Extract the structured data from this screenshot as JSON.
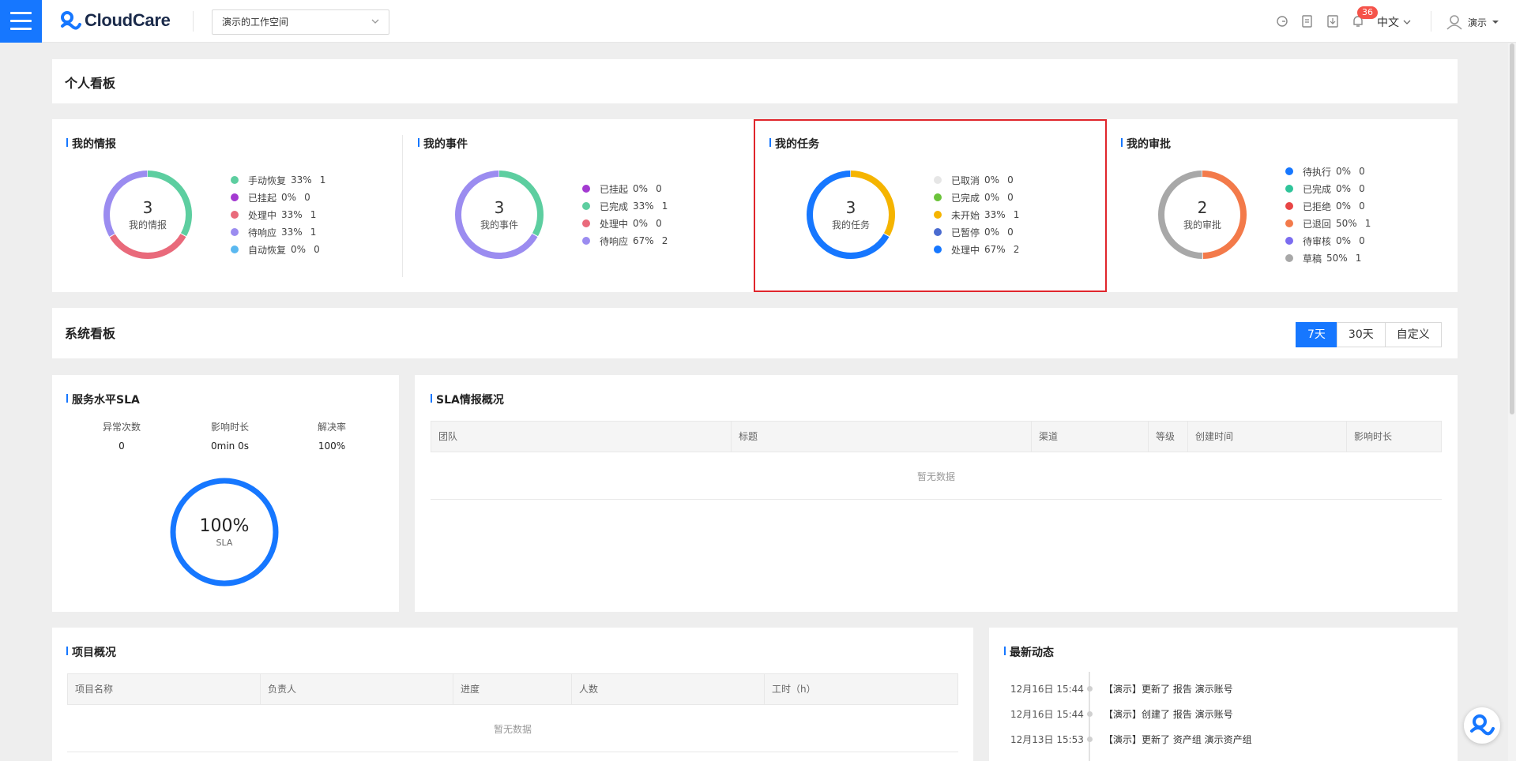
{
  "header": {
    "menu_icon": "hamburger-menu-icon",
    "logo_text": "CloudCare",
    "workspace": "演示的工作空间",
    "notifications_count": "36",
    "language": "中文",
    "user_name": "演示"
  },
  "personal_board": {
    "title": "个人看板",
    "sections": [
      {
        "title": "我的情报",
        "total": "3",
        "center_label": "我的情报",
        "legend": [
          {
            "label": "手动恢复",
            "pct": "33%",
            "count": "1",
            "color": "#5dcea0"
          },
          {
            "label": "已挂起",
            "pct": "0%",
            "count": "0",
            "color": "#a33ad1"
          },
          {
            "label": "处理中",
            "pct": "33%",
            "count": "1",
            "color": "#e96a7b"
          },
          {
            "label": "待响应",
            "pct": "33%",
            "count": "1",
            "color": "#9b8cf0"
          },
          {
            "label": "自动恢复",
            "pct": "0%",
            "count": "0",
            "color": "#5ab8f0"
          }
        ]
      },
      {
        "title": "我的事件",
        "total": "3",
        "center_label": "我的事件",
        "legend": [
          {
            "label": "已挂起",
            "pct": "0%",
            "count": "0",
            "color": "#a33ad1"
          },
          {
            "label": "已完成",
            "pct": "33%",
            "count": "1",
            "color": "#5dcea0"
          },
          {
            "label": "处理中",
            "pct": "0%",
            "count": "0",
            "color": "#e96a7b"
          },
          {
            "label": "待响应",
            "pct": "67%",
            "count": "2",
            "color": "#9b8cf0"
          }
        ]
      },
      {
        "title": "我的任务",
        "total": "3",
        "center_label": "我的任务",
        "legend": [
          {
            "label": "已取消",
            "pct": "0%",
            "count": "0",
            "color": "#e6e6e6"
          },
          {
            "label": "已完成",
            "pct": "0%",
            "count": "0",
            "color": "#6bc33a"
          },
          {
            "label": "未开始",
            "pct": "33%",
            "count": "1",
            "color": "#f5b400"
          },
          {
            "label": "已暂停",
            "pct": "0%",
            "count": "0",
            "color": "#4a6bd0"
          },
          {
            "label": "处理中",
            "pct": "67%",
            "count": "2",
            "color": "#1677ff"
          }
        ]
      },
      {
        "title": "我的审批",
        "total": "2",
        "center_label": "我的审批",
        "legend": [
          {
            "label": "待执行",
            "pct": "0%",
            "count": "0",
            "color": "#1677ff"
          },
          {
            "label": "已完成",
            "pct": "0%",
            "count": "0",
            "color": "#2fc49a"
          },
          {
            "label": "已拒绝",
            "pct": "0%",
            "count": "0",
            "color": "#e84545"
          },
          {
            "label": "已退回",
            "pct": "50%",
            "count": "1",
            "color": "#f37a4a"
          },
          {
            "label": "待审核",
            "pct": "0%",
            "count": "0",
            "color": "#7b6cf0"
          },
          {
            "label": "草稿",
            "pct": "50%",
            "count": "1",
            "color": "#a8a8a8"
          }
        ]
      }
    ]
  },
  "system_board": {
    "title": "系统看板",
    "tabs": [
      "7天",
      "30天",
      "自定义"
    ],
    "active_tab": "7天"
  },
  "sla": {
    "title": "服务水平SLA",
    "stats": [
      {
        "label": "异常次数",
        "value": "0"
      },
      {
        "label": "影响时长",
        "value": "0min 0s"
      },
      {
        "label": "解决率",
        "value": "100%"
      }
    ],
    "gauge_value": "100%",
    "gauge_label": "SLA",
    "gauge_fraction": 1.0,
    "gauge_color": "#1677ff"
  },
  "sla_overview": {
    "title": "SLA情报概况",
    "columns": [
      "团队",
      "标题",
      "渠道",
      "等级",
      "创建时间",
      "影响时长"
    ],
    "empty_text": "暂无数据"
  },
  "projects": {
    "title": "项目概况",
    "columns": [
      "项目名称",
      "负责人",
      "进度",
      "人数",
      "工时（h）"
    ],
    "empty_text": "暂无数据"
  },
  "activity": {
    "title": "最新动态",
    "items": [
      {
        "time": "12月16日 15:44",
        "text": "【演示】更新了 报告 演示账号"
      },
      {
        "time": "12月16日 15:44",
        "text": "【演示】创建了 报告 演示账号"
      },
      {
        "time": "12月13日 15:53",
        "text": "【演示】更新了 资产组 演示资产组"
      }
    ]
  },
  "colors": {
    "accent": "#1677ff",
    "highlight_border": "#e0262c",
    "badge": "#f5534a"
  }
}
